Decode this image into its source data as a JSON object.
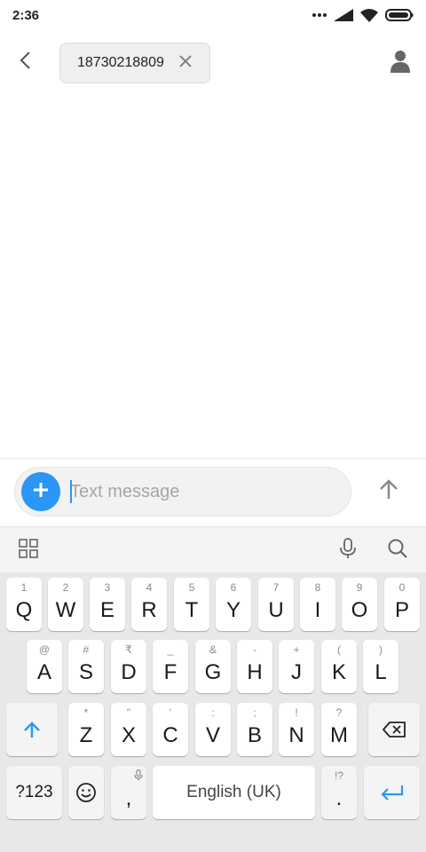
{
  "status_bar": {
    "time": "2:36",
    "icons": [
      "more-dots-icon",
      "cellular-signal-icon",
      "wifi-icon",
      "battery-icon"
    ]
  },
  "header": {
    "back_icon": "back-arrow-icon",
    "recipient": "18730218809",
    "remove_icon": "close-icon",
    "contact_icon": "person-icon"
  },
  "compose": {
    "add_icon": "plus-icon",
    "placeholder": "Text message",
    "value": "",
    "send_icon": "send-arrow-icon"
  },
  "keyboard_toolbar": {
    "icons": [
      "apps-grid-icon",
      "microphone-icon",
      "search-icon"
    ]
  },
  "keyboard": {
    "row1": [
      {
        "key": "Q",
        "hint": "1"
      },
      {
        "key": "W",
        "hint": "2"
      },
      {
        "key": "E",
        "hint": "3"
      },
      {
        "key": "R",
        "hint": "4"
      },
      {
        "key": "T",
        "hint": "5"
      },
      {
        "key": "Y",
        "hint": "6"
      },
      {
        "key": "U",
        "hint": "7"
      },
      {
        "key": "I",
        "hint": "8"
      },
      {
        "key": "O",
        "hint": "9"
      },
      {
        "key": "P",
        "hint": "0"
      }
    ],
    "row2": [
      {
        "key": "A",
        "hint": "@"
      },
      {
        "key": "S",
        "hint": "#"
      },
      {
        "key": "D",
        "hint": "₹"
      },
      {
        "key": "F",
        "hint": "_"
      },
      {
        "key": "G",
        "hint": "&"
      },
      {
        "key": "H",
        "hint": "-"
      },
      {
        "key": "J",
        "hint": "+"
      },
      {
        "key": "K",
        "hint": "("
      },
      {
        "key": "L",
        "hint": ")"
      }
    ],
    "row3": [
      {
        "key": "Z",
        "hint": "*"
      },
      {
        "key": "X",
        "hint": "\""
      },
      {
        "key": "C",
        "hint": "'"
      },
      {
        "key": "V",
        "hint": ":"
      },
      {
        "key": "B",
        "hint": ";"
      },
      {
        "key": "N",
        "hint": "!"
      },
      {
        "key": "M",
        "hint": "?"
      }
    ],
    "shift_icon": "shift-arrow-icon",
    "backspace_icon": "backspace-icon",
    "symbols_label": "?123",
    "emoji_icon": "emoji-icon",
    "comma": {
      "key": ",",
      "hint_icon": "microphone-icon"
    },
    "space_label": "English (UK)",
    "period": {
      "key": ".",
      "hint": "!?"
    },
    "enter_icon": "enter-arrow-icon"
  },
  "colors": {
    "accent": "#2b96f5",
    "keyboard_bg": "#e8e8e8",
    "key_bg": "#ffffff",
    "placeholder": "#a6a6a6"
  }
}
